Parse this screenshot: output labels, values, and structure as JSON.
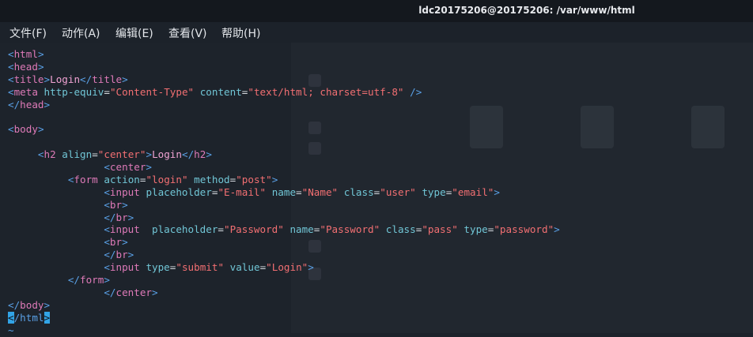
{
  "window": {
    "title": "ldc20175206@20175206: /var/www/html"
  },
  "menu": [
    "文件(F)",
    "动作(A)",
    "编辑(E)",
    "查看(V)",
    "帮助(H)"
  ],
  "colors": {
    "background": "#1d232b",
    "tag": "#5aa0e6",
    "tag_name": "#de7ab8",
    "attribute": "#71c6d6",
    "string": "#f26f72",
    "cursor": "#32a4e6"
  },
  "code_lines": [
    [
      [
        "t",
        "<"
      ],
      [
        "n",
        "html"
      ],
      [
        "t",
        ">"
      ]
    ],
    [
      [
        "t",
        "<"
      ],
      [
        "n",
        "head"
      ],
      [
        "t",
        ">"
      ]
    ],
    [
      [
        "t",
        "<"
      ],
      [
        "n",
        "title"
      ],
      [
        "t",
        ">"
      ],
      [
        "x",
        "Login"
      ],
      [
        "t",
        "</"
      ],
      [
        "n",
        "title"
      ],
      [
        "t",
        ">"
      ]
    ],
    [
      [
        "t",
        "<"
      ],
      [
        "n",
        "meta"
      ],
      [
        "p",
        " "
      ],
      [
        "a",
        "http-equiv"
      ],
      [
        "p",
        "="
      ],
      [
        "s",
        "\"Content-Type\""
      ],
      [
        "p",
        " "
      ],
      [
        "a",
        "content"
      ],
      [
        "p",
        "="
      ],
      [
        "s",
        "\"text/html; charset=utf-8\""
      ],
      [
        "p",
        " "
      ],
      [
        "t",
        "/>"
      ]
    ],
    [
      [
        "t",
        "</"
      ],
      [
        "n",
        "head"
      ],
      [
        "t",
        ">"
      ]
    ],
    [],
    [
      [
        "t",
        "<"
      ],
      [
        "n",
        "body"
      ],
      [
        "t",
        ">"
      ]
    ],
    [],
    [
      [
        "p",
        "     "
      ],
      [
        "t",
        "<"
      ],
      [
        "n",
        "h2"
      ],
      [
        "p",
        " "
      ],
      [
        "a",
        "align"
      ],
      [
        "p",
        "="
      ],
      [
        "s",
        "\"center\""
      ],
      [
        "t",
        ">"
      ],
      [
        "x",
        "Login"
      ],
      [
        "t",
        "</"
      ],
      [
        "n",
        "h2"
      ],
      [
        "t",
        ">"
      ]
    ],
    [
      [
        "p",
        "                "
      ],
      [
        "t",
        "<"
      ],
      [
        "n",
        "center"
      ],
      [
        "t",
        ">"
      ]
    ],
    [
      [
        "p",
        "          "
      ],
      [
        "t",
        "<"
      ],
      [
        "n",
        "form"
      ],
      [
        "p",
        " "
      ],
      [
        "a",
        "action"
      ],
      [
        "p",
        "="
      ],
      [
        "s",
        "\"login\""
      ],
      [
        "p",
        " "
      ],
      [
        "a",
        "method"
      ],
      [
        "p",
        "="
      ],
      [
        "s",
        "\"post\""
      ],
      [
        "t",
        ">"
      ]
    ],
    [
      [
        "p",
        "                "
      ],
      [
        "t",
        "<"
      ],
      [
        "n",
        "input"
      ],
      [
        "p",
        " "
      ],
      [
        "a",
        "placeholder"
      ],
      [
        "p",
        "="
      ],
      [
        "s",
        "\"E-mail\""
      ],
      [
        "p",
        " "
      ],
      [
        "a",
        "name"
      ],
      [
        "p",
        "="
      ],
      [
        "s",
        "\"Name\""
      ],
      [
        "p",
        " "
      ],
      [
        "a",
        "class"
      ],
      [
        "p",
        "="
      ],
      [
        "s",
        "\"user\""
      ],
      [
        "p",
        " "
      ],
      [
        "a",
        "type"
      ],
      [
        "p",
        "="
      ],
      [
        "s",
        "\"email\""
      ],
      [
        "t",
        ">"
      ]
    ],
    [
      [
        "p",
        "                "
      ],
      [
        "t",
        "<"
      ],
      [
        "n",
        "br"
      ],
      [
        "t",
        ">"
      ]
    ],
    [
      [
        "p",
        "                "
      ],
      [
        "t",
        "</"
      ],
      [
        "n",
        "br"
      ],
      [
        "t",
        ">"
      ]
    ],
    [
      [
        "p",
        "                "
      ],
      [
        "t",
        "<"
      ],
      [
        "n",
        "input"
      ],
      [
        "p",
        "  "
      ],
      [
        "a",
        "placeholder"
      ],
      [
        "p",
        "="
      ],
      [
        "s",
        "\"Password\""
      ],
      [
        "p",
        " "
      ],
      [
        "a",
        "name"
      ],
      [
        "p",
        "="
      ],
      [
        "s",
        "\"Password\""
      ],
      [
        "p",
        " "
      ],
      [
        "a",
        "class"
      ],
      [
        "p",
        "="
      ],
      [
        "s",
        "\"pass\""
      ],
      [
        "p",
        " "
      ],
      [
        "a",
        "type"
      ],
      [
        "p",
        "="
      ],
      [
        "s",
        "\"password\""
      ],
      [
        "t",
        ">"
      ]
    ],
    [
      [
        "p",
        "                "
      ],
      [
        "t",
        "<"
      ],
      [
        "n",
        "br"
      ],
      [
        "t",
        ">"
      ]
    ],
    [
      [
        "p",
        "                "
      ],
      [
        "t",
        "</"
      ],
      [
        "n",
        "br"
      ],
      [
        "t",
        ">"
      ]
    ],
    [
      [
        "p",
        "                "
      ],
      [
        "t",
        "<"
      ],
      [
        "n",
        "input"
      ],
      [
        "p",
        " "
      ],
      [
        "a",
        "type"
      ],
      [
        "p",
        "="
      ],
      [
        "s",
        "\"submit\""
      ],
      [
        "p",
        " "
      ],
      [
        "a",
        "value"
      ],
      [
        "p",
        "="
      ],
      [
        "s",
        "\"Login\""
      ],
      [
        "t",
        ">"
      ]
    ],
    [
      [
        "p",
        "          "
      ],
      [
        "t",
        "</"
      ],
      [
        "n",
        "form"
      ],
      [
        "t",
        ">"
      ]
    ],
    [
      [
        "p",
        "                "
      ],
      [
        "t",
        "</"
      ],
      [
        "n",
        "center"
      ],
      [
        "t",
        ">"
      ]
    ],
    [
      [
        "t",
        "</"
      ],
      [
        "n",
        "body"
      ],
      [
        "t",
        ">"
      ]
    ],
    [
      [
        "c",
        "<"
      ],
      [
        "t",
        "/html"
      ],
      [
        "c",
        ">"
      ]
    ],
    [
      [
        "tilde",
        "~"
      ]
    ]
  ]
}
